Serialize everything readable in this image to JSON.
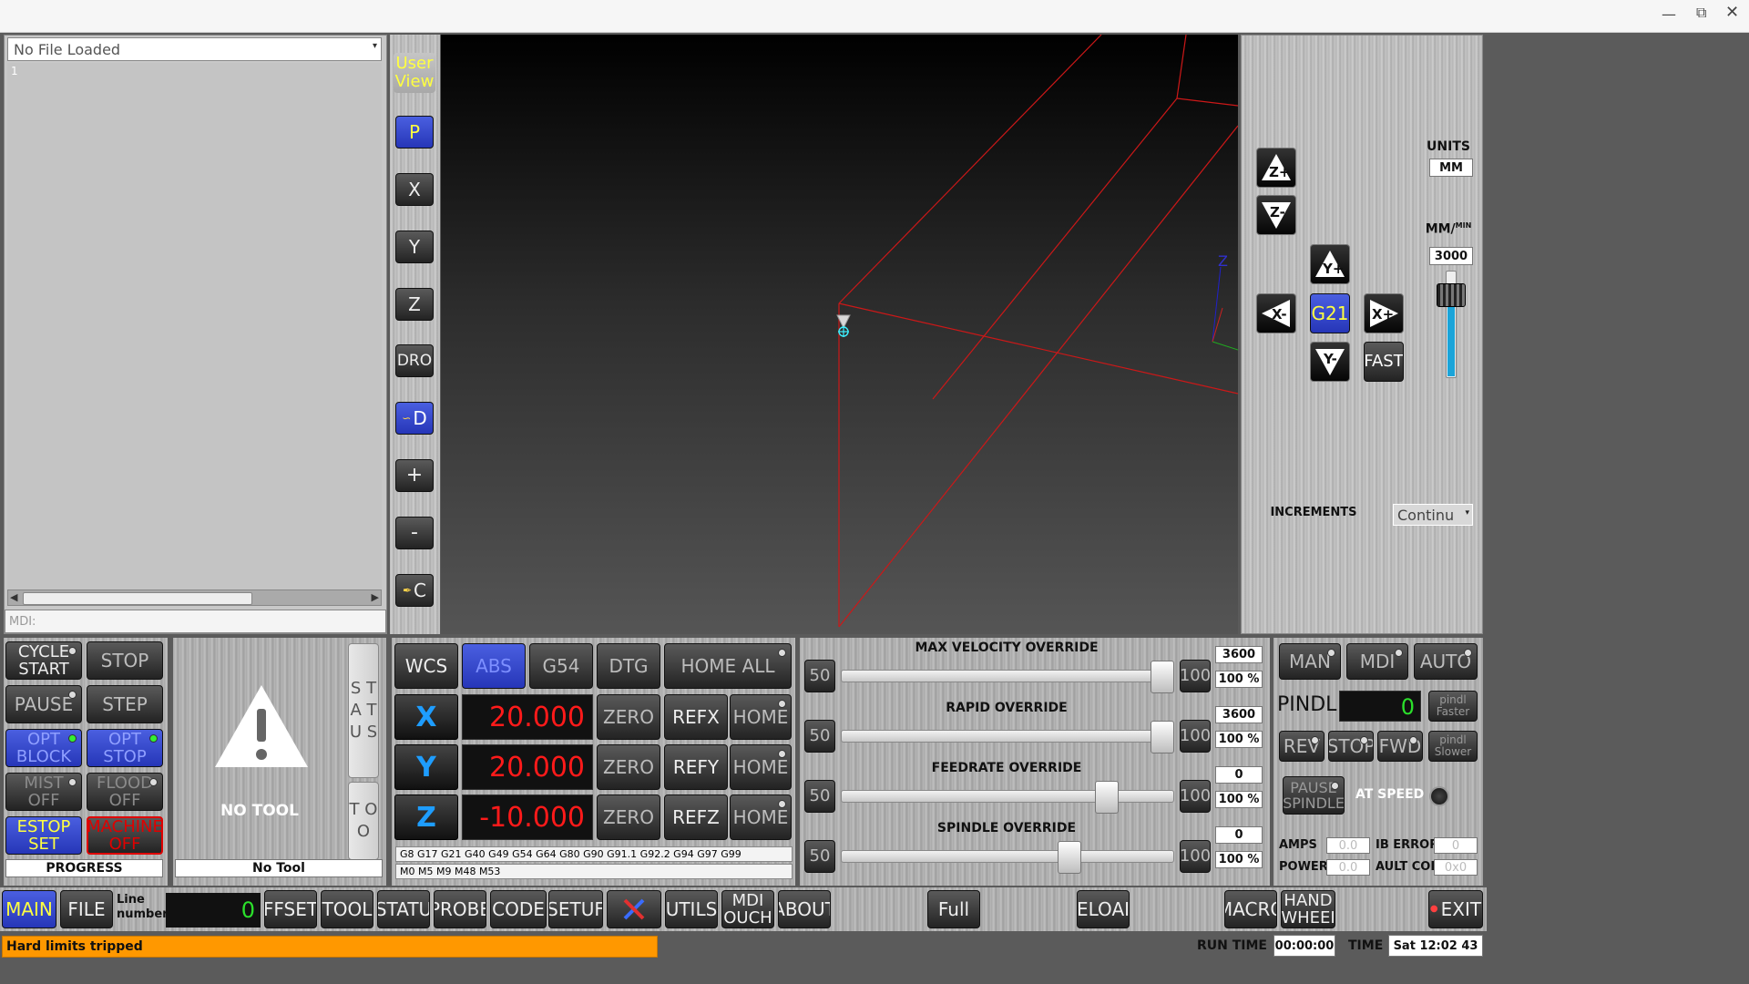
{
  "gcode_panel": {
    "file_select": "No File Loaded",
    "line_number": "1",
    "mdi_label": "MDI:"
  },
  "view_buttons": [
    {
      "label": "User View",
      "name": "user-view-button"
    },
    {
      "label": "P",
      "name": "view-p-button"
    },
    {
      "label": "X",
      "name": "view-x-button"
    },
    {
      "label": "Y",
      "name": "view-y-button"
    },
    {
      "label": "Z",
      "name": "view-z-button"
    },
    {
      "label": "DRO",
      "name": "view-dro-button"
    },
    {
      "label": "D",
      "name": "view-d-button"
    },
    {
      "label": "+",
      "name": "zoom-in-button"
    },
    {
      "label": "-",
      "name": "zoom-out-button"
    },
    {
      "label": "C",
      "name": "clear-button"
    }
  ],
  "jog": {
    "units_label": "UNITS",
    "units_value": "MM",
    "rate_label": "MM/",
    "rate_label_sup": "MIN",
    "rate_value": "3000",
    "rate_fraction": 0.85,
    "center_label": "G21",
    "fast_label": "FAST",
    "increments_label": "INCREMENTS",
    "increments_value": "Continu"
  },
  "run_controls": {
    "cycle_start": "CYCLE START",
    "stop": "STOP",
    "pause": "PAUSE",
    "step": "STEP",
    "opt_block": "OPT BLOCK",
    "opt_stop": "OPT STOP",
    "mist_off": "MIST OFF",
    "flood_off": "FLOOD OFF",
    "estop_set": "ESTOP SET",
    "machine_off": "MACHINE OFF",
    "progress": "PROGRESS"
  },
  "tool": {
    "status_tab": "S T A T U S",
    "tool_tab": "T O O",
    "no_tool_big": "NO TOOL",
    "no_tool_field": "No Tool"
  },
  "dro": {
    "wcs": "WCS",
    "abs": "ABS",
    "g54": "G54",
    "dtg": "DTG",
    "home_all": "HOME ALL",
    "axes": [
      {
        "axis": "X",
        "value": "20.000",
        "ref": "REFX"
      },
      {
        "axis": "Y",
        "value": "20.000",
        "ref": "REFY"
      },
      {
        "axis": "Z",
        "value": "-10.000",
        "ref": "REFZ"
      }
    ],
    "zero": "ZERO",
    "home": "HOME",
    "gcodes": "G8 G17 G21 G40 G49 G54 G64 G80 G90 G91.1 G92.2 G94 G97 G99",
    "mcodes": "M0 M5 M9 M48 M53"
  },
  "overrides": [
    {
      "title": "MAX VELOCITY OVERRIDE",
      "min": "50",
      "max": "100",
      "value": "3600",
      "percent": "100 %",
      "fraction": 1.0
    },
    {
      "title": "RAPID OVERRIDE",
      "min": "50",
      "max": "100",
      "value": "3600",
      "percent": "100 %",
      "fraction": 1.0
    },
    {
      "title": "FEEDRATE OVERRIDE",
      "min": "50",
      "max": "100",
      "value": "0",
      "percent": "100 %",
      "fraction": 0.82
    },
    {
      "title": "SPINDLE OVERRIDE",
      "min": "50",
      "max": "100",
      "value": "0",
      "percent": "100 %",
      "fraction": 0.7
    }
  ],
  "spindle": {
    "man": "MAN",
    "mdi": "MDI",
    "auto": "AUTO",
    "label": "PINDL",
    "rpm": "0",
    "faster": "pindl Faster",
    "rev": "REV",
    "stop": "STOP",
    "fwd": "FWD",
    "slower": "pindl Slower",
    "pause": "PAUSE SPINDLE",
    "at_speed": "AT SPEED",
    "amps_label": "AMPS",
    "amps_value": "0.0",
    "mb_error_label": "IB ERROR",
    "mb_error_value": "0",
    "power_label": "POWER",
    "power_value": "0.0",
    "fault_label": "AULT COD",
    "fault_value": "0x0"
  },
  "bottom_bar": {
    "main": "MAIN",
    "file": "FILE",
    "line_number_label": "Line number",
    "line_number_value": "0",
    "offset": "FFSET",
    "tool": "TOOL",
    "status": "STATU",
    "probe": "PROBE",
    "gcode": "CODE",
    "setup": "SETUF",
    "utils": "UTILS",
    "mdi_touch": "MDI OUCH",
    "about": "ABOUT",
    "full": "Full",
    "reload": "ELOAI",
    "macro": "MACRO",
    "hand_wheel": "HAND WHEEI",
    "exit": "EXIT"
  },
  "status_bar": {
    "message": "Hard limits tripped",
    "run_time_label": "RUN TIME",
    "run_time_value": "00:00:00",
    "time_label": "TIME",
    "time_value": "Sat 12:02 43"
  },
  "colors": {
    "dro_red": "#ff1a1a",
    "axis_blue": "#1e9dff",
    "alert_orange": "#ff9800",
    "toggle_blue": "#2636b8",
    "estop_yellow": "#ffff40",
    "machine_red": "#e00000"
  }
}
